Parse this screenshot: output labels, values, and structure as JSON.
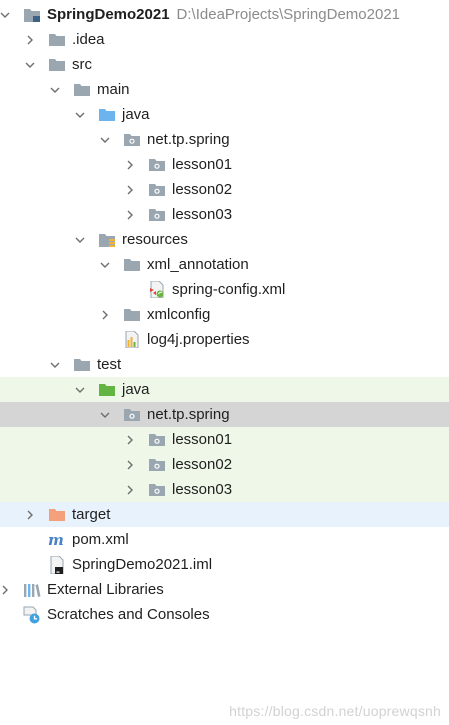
{
  "project": {
    "name": "SpringDemo2021",
    "path": "D:\\IdeaProjects\\SpringDemo2021"
  },
  "tree": [
    {
      "id": "root",
      "label": "SpringDemo2021",
      "suffix": "D:\\IdeaProjects\\SpringDemo2021",
      "icon": "project-folder-icon",
      "expanded": true,
      "bold": true,
      "level": 0
    },
    {
      "id": "idea",
      "label": ".idea",
      "icon": "folder-icon",
      "expanded": false,
      "level": 1
    },
    {
      "id": "src",
      "label": "src",
      "icon": "folder-icon",
      "expanded": true,
      "level": 1
    },
    {
      "id": "main",
      "label": "main",
      "icon": "folder-icon",
      "expanded": true,
      "level": 2
    },
    {
      "id": "main-java",
      "label": "java",
      "icon": "source-root-folder-icon",
      "expanded": true,
      "level": 3
    },
    {
      "id": "main-pkg",
      "label": "net.tp.spring",
      "icon": "package-icon",
      "expanded": true,
      "level": 4
    },
    {
      "id": "main-lesson01",
      "label": "lesson01",
      "icon": "package-icon",
      "expanded": false,
      "level": 5
    },
    {
      "id": "main-lesson02",
      "label": "lesson02",
      "icon": "package-icon",
      "expanded": false,
      "level": 5
    },
    {
      "id": "main-lesson03",
      "label": "lesson03",
      "icon": "package-icon",
      "expanded": false,
      "level": 5
    },
    {
      "id": "resources",
      "label": "resources",
      "icon": "resources-folder-icon",
      "expanded": true,
      "level": 3
    },
    {
      "id": "xml-annotation",
      "label": "xml_annotation",
      "icon": "folder-icon",
      "expanded": true,
      "level": 4
    },
    {
      "id": "spring-config",
      "label": "spring-config.xml",
      "icon": "spring-xml-file-icon",
      "level": 5,
      "leaf": true
    },
    {
      "id": "xmlconfig",
      "label": "xmlconfig",
      "icon": "folder-icon",
      "expanded": false,
      "level": 4
    },
    {
      "id": "log4j",
      "label": "log4j.properties",
      "icon": "properties-file-icon",
      "level": 4,
      "leaf": true
    },
    {
      "id": "test",
      "label": "test",
      "icon": "folder-icon",
      "expanded": true,
      "level": 2
    },
    {
      "id": "test-java",
      "label": "java",
      "icon": "test-root-folder-icon",
      "expanded": true,
      "level": 3,
      "bg": "green"
    },
    {
      "id": "test-pkg",
      "label": "net.tp.spring",
      "icon": "package-icon",
      "expanded": true,
      "level": 4,
      "bg": "selected"
    },
    {
      "id": "test-lesson01",
      "label": "lesson01",
      "icon": "package-icon",
      "expanded": false,
      "level": 5,
      "bg": "green"
    },
    {
      "id": "test-lesson02",
      "label": "lesson02",
      "icon": "package-icon",
      "expanded": false,
      "level": 5,
      "bg": "green"
    },
    {
      "id": "test-lesson03",
      "label": "lesson03",
      "icon": "package-icon",
      "expanded": false,
      "level": 5,
      "bg": "green"
    },
    {
      "id": "target",
      "label": "target",
      "icon": "excluded-folder-icon",
      "expanded": false,
      "level": 1,
      "bg": "blue"
    },
    {
      "id": "pom",
      "label": "pom.xml",
      "icon": "maven-file-icon",
      "level": 1,
      "leaf": true
    },
    {
      "id": "iml",
      "label": "SpringDemo2021.iml",
      "icon": "module-file-icon",
      "level": 1,
      "leaf": true
    },
    {
      "id": "ext-libs",
      "label": "External Libraries",
      "icon": "libraries-icon",
      "expanded": false,
      "level": 0
    },
    {
      "id": "scratches",
      "label": "Scratches and Consoles",
      "icon": "scratches-icon",
      "level": 0,
      "leaf": true
    }
  ],
  "colors": {
    "folder": "#9aa7b0",
    "source_root": "#6cb4ee",
    "test_root": "#62b543",
    "excluded": "#f4a07a",
    "selected_bg": "#d5d5d5",
    "test_bg": "#eff8e8",
    "excluded_bg": "#e8f2fd",
    "path_text": "#8b8b8b"
  },
  "watermark": "https://blog.csdn.net/uoprewqsnh"
}
